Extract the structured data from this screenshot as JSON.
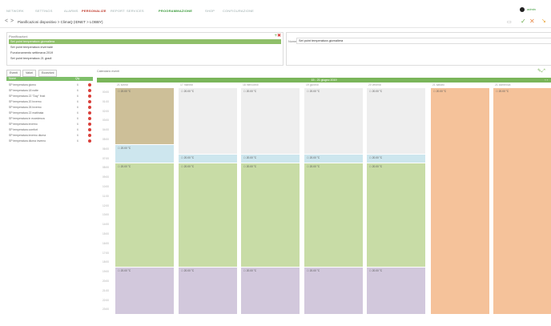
{
  "nav": {
    "items": [
      "NETWORK",
      "SETTINGS",
      "ALARMS",
      "PERSONALIZE",
      "REPORT",
      "SERVICES",
      "PROGRAMMAZIONE",
      "SHOP",
      "CONFIGURAZIONE"
    ],
    "user": "admin"
  },
  "breadcrumb": {
    "back": "<",
    "forward": ">",
    "text": "Pianificazioni dispositivo > ClimaQ (IDNET > LOBBY)"
  },
  "toolbar": {
    "icons": [
      "print-icon",
      "save-icon",
      "cancel-icon",
      "close-icon"
    ]
  },
  "planList": {
    "header": "Pianificazioni",
    "rows": [
      "Set point temperatura giornaliera",
      "Set point temperatura invernale",
      "Funzionamento settimana 2019",
      "Set point temperatura 21 gradi"
    ],
    "selectedIndex": 0
  },
  "nameField": {
    "label": "Nome",
    "value": "Set point temperatura giornaliera"
  },
  "tabs": [
    "Eventi",
    "Valori",
    "Eccezioni"
  ],
  "listHeader": {
    "name": "Nome",
    "qty": "Qty"
  },
  "events": [
    {
      "name": "SP temperatura giorno",
      "qty": "6"
    },
    {
      "name": "SP temperatura 18 notte",
      "qty": "6"
    },
    {
      "name": "SP temperatura 22 \"Day\" frost",
      "qty": "6"
    },
    {
      "name": "SP temperatura 20 Inverno",
      "qty": "6"
    },
    {
      "name": "SP temperatura 26 Inverno",
      "qty": "6"
    },
    {
      "name": "SP temperatura 22 mattinata",
      "qty": "6"
    },
    {
      "name": "SP temperatura in eccedenza",
      "qty": "6"
    },
    {
      "name": "SP temperatura inverno",
      "qty": "6"
    },
    {
      "name": "SP temperatura comfort",
      "qty": "6"
    },
    {
      "name": "SP temperatura inverno diurna",
      "qty": "6"
    },
    {
      "name": "SP temperatura diurna inverno",
      "qty": "6"
    }
  ],
  "calendar": {
    "title": "Calendario eventi",
    "range": "15 - 21 giugno 2019",
    "days": [
      "21 lunedì",
      "17 martedì",
      "18 mercoledì",
      "19 giovedì",
      "20 venerdì",
      "21 sabato",
      "21 domenica"
    ],
    "times": [
      "00:00",
      "01:00",
      "02:00",
      "03:00",
      "04:00",
      "05:00",
      "06:00",
      "07:00",
      "08:00",
      "09:00",
      "10:00",
      "11:00",
      "12:00",
      "13:00",
      "14:00",
      "15:00",
      "16:00",
      "17:00",
      "18:00",
      "19:00",
      "20:00",
      "21:00",
      "22:00",
      "23:00"
    ],
    "blockLabel": "20.00 °C",
    "colors": {
      "tan": "#cdbf98",
      "gray": "#eeeeee",
      "blue": "#cde6ee",
      "green": "#c8dca6",
      "purple": "#d2c8dc",
      "orange": "#f5c29a",
      "accent": "#7ab55a"
    }
  }
}
